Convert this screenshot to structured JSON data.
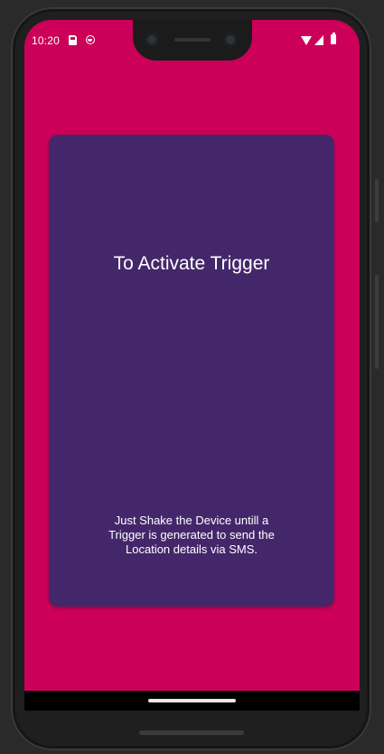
{
  "status_bar": {
    "time": "10:20"
  },
  "icons": {
    "sd_card": "sd-card-icon",
    "notification": "emoji-icon",
    "wifi": "wifi-icon",
    "signal": "cellular-signal-icon",
    "battery": "battery-icon"
  },
  "colors": {
    "background": "#cc0059",
    "card": "#44276a",
    "text": "#ffffff",
    "nav_bar": "#000000"
  },
  "card": {
    "title": "To Activate Trigger",
    "description": "Just Shake the Device untill a Trigger is generated to send the Location details via SMS."
  }
}
